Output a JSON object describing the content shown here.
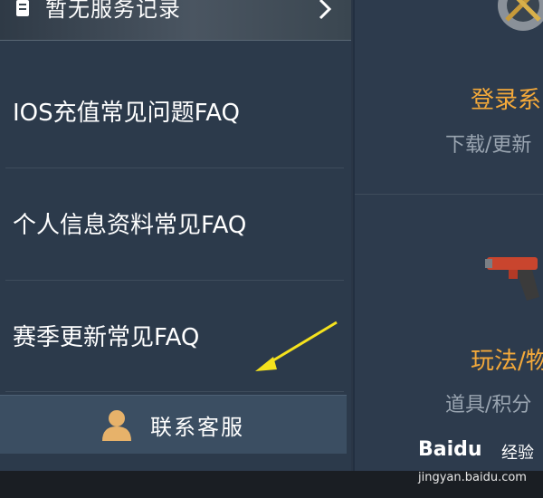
{
  "header": {
    "title": "暂无服务记录"
  },
  "faq": [
    {
      "label": "IOS充值常见问题FAQ"
    },
    {
      "label": "个人信息资料常见FAQ"
    },
    {
      "label": "赛季更新常见FAQ"
    }
  ],
  "contact": {
    "label": "联系客服"
  },
  "cards": [
    {
      "title": "登录系",
      "subtitle": "下载/更新",
      "icon": "gear-tools-icon"
    },
    {
      "title": "玩法/物",
      "subtitle": "道具/积分",
      "icon": "flare-gun-icon"
    }
  ],
  "watermark": {
    "brand": "Baidu",
    "suffix": "经验",
    "url": "jingyan.baidu.com"
  },
  "colors": {
    "accent": "#f4a93a",
    "arrow": "#f5e21d",
    "panel": "#2c3a4b",
    "button": "#3b4e62"
  }
}
